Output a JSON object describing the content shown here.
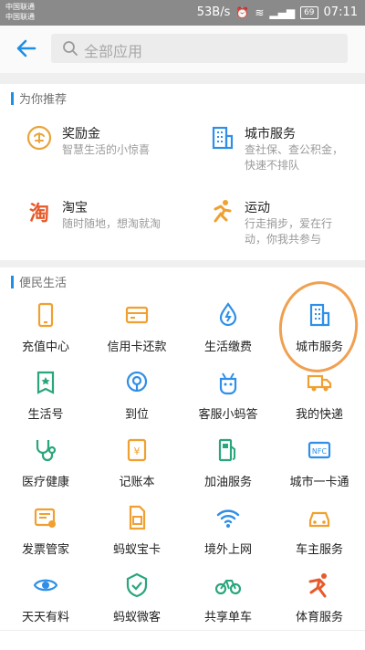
{
  "status_bar": {
    "carrier1": "中国联通",
    "carrier2": "中国联通",
    "speed": "53B/s",
    "battery": "69",
    "time": "07:11"
  },
  "header": {
    "search_placeholder": "全部应用"
  },
  "recommend": {
    "title": "为你推荐",
    "items": [
      {
        "title": "奖励金",
        "desc": "智慧生活的小惊喜",
        "icon": "reward-coin-icon",
        "color": "#e8a53a"
      },
      {
        "title": "城市服务",
        "desc": "查社保、查公积金，快速不排队",
        "icon": "city-building-icon",
        "color": "#2f8fe8"
      },
      {
        "title": "淘宝",
        "desc": "随时随地，想淘就淘",
        "icon": "taobao-icon",
        "color": "#e65a2c"
      },
      {
        "title": "运动",
        "desc": "行走捐步，爱在行动，你我共参与",
        "icon": "running-icon",
        "color": "#f0a030"
      }
    ]
  },
  "convenience": {
    "title": "便民生活",
    "items": [
      {
        "label": "充值中心",
        "icon": "phone-icon"
      },
      {
        "label": "信用卡还款",
        "icon": "credit-card-icon"
      },
      {
        "label": "生活缴费",
        "icon": "utility-drop-icon"
      },
      {
        "label": "城市服务",
        "icon": "city-building-icon"
      },
      {
        "label": "生活号",
        "icon": "star-badge-icon"
      },
      {
        "label": "到位",
        "icon": "location-pin-icon"
      },
      {
        "label": "客服小蚂答",
        "icon": "robot-icon"
      },
      {
        "label": "我的快递",
        "icon": "delivery-truck-icon"
      },
      {
        "label": "医疗健康",
        "icon": "stethoscope-icon"
      },
      {
        "label": "记账本",
        "icon": "ledger-icon"
      },
      {
        "label": "加油服务",
        "icon": "fuel-pump-icon"
      },
      {
        "label": "城市一卡通",
        "icon": "transit-card-icon"
      },
      {
        "label": "发票管家",
        "icon": "invoice-icon"
      },
      {
        "label": "蚂蚁宝卡",
        "icon": "sim-card-icon"
      },
      {
        "label": "境外上网",
        "icon": "wifi-icon"
      },
      {
        "label": "车主服务",
        "icon": "car-icon"
      },
      {
        "label": "天天有料",
        "icon": "eye-icon"
      },
      {
        "label": "蚂蚁微客",
        "icon": "shield-check-icon"
      },
      {
        "label": "共享单车",
        "icon": "bicycle-icon"
      },
      {
        "label": "体育服务",
        "icon": "sport-figure-icon"
      }
    ]
  },
  "colors": {
    "accent": "#1e8fe6",
    "icon_orange": "#f0a030",
    "annotation": "#f0a050"
  }
}
